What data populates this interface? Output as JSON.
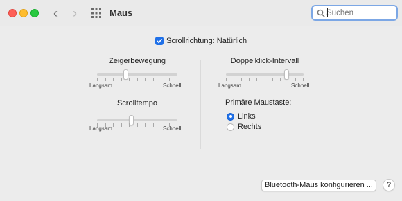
{
  "window": {
    "title": "Maus"
  },
  "toolbar": {
    "back_icon": "chevron-left-icon",
    "forward_icon": "chevron-right-icon",
    "grid_icon": "grid-icon",
    "back_glyph": "‹",
    "forward_glyph": "›"
  },
  "search": {
    "placeholder": "Suchen",
    "value": ""
  },
  "scroll_direction": {
    "label": "Scrollrichtung: Natürlich",
    "checked": true
  },
  "pointer_speed": {
    "title": "Zeigerbewegung",
    "min_label": "Langsam",
    "max_label": "Schnell",
    "value_fraction": 0.35
  },
  "scroll_speed": {
    "title": "Scrolltempo",
    "min_label": "Langsam",
    "max_label": "Schnell",
    "value_fraction": 0.42
  },
  "double_click": {
    "title": "Doppelklick-Intervall",
    "min_label": "Langsam",
    "max_label": "Schnell",
    "value_fraction": 0.8
  },
  "primary_button": {
    "title": "Primäre Maustaste:",
    "options": [
      {
        "label": "Links",
        "selected": true
      },
      {
        "label": "Rechts",
        "selected": false
      }
    ]
  },
  "footer": {
    "bluetooth_button": "Bluetooth-Maus konfigurieren ...",
    "help_button": "?"
  },
  "colors": {
    "accent": "#1f70e8",
    "close": "#fe5f57",
    "minimize": "#febc2e",
    "maximize": "#28c840"
  }
}
